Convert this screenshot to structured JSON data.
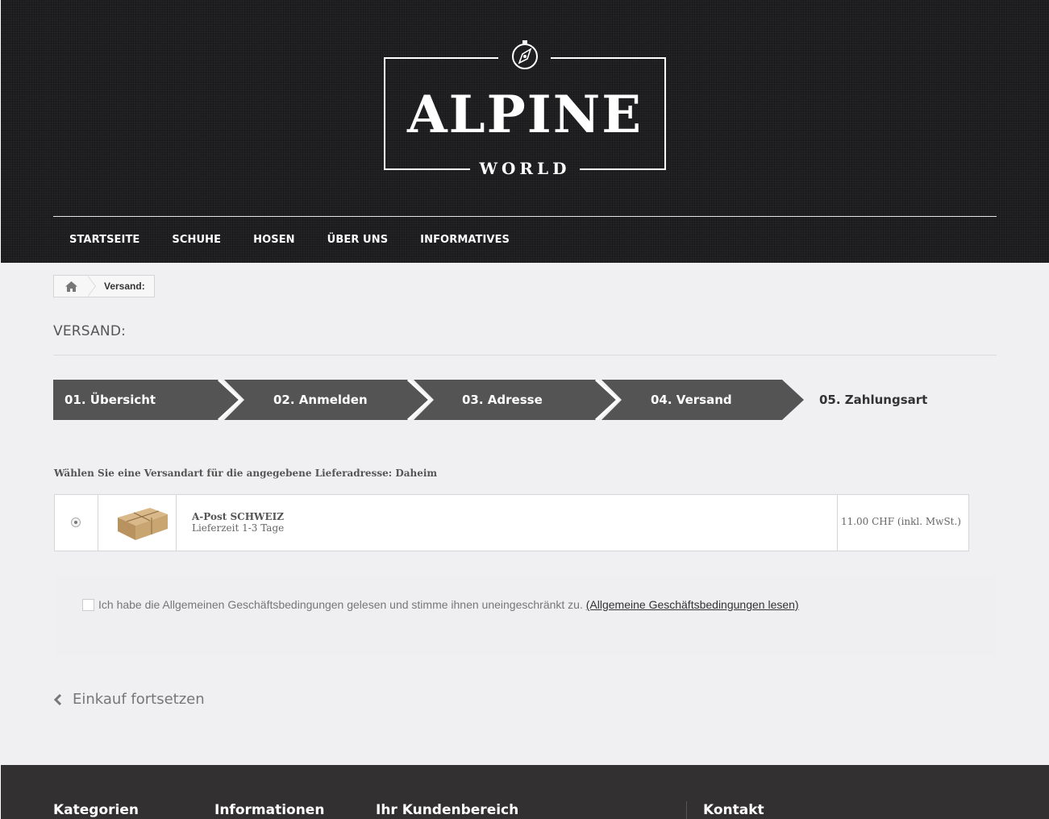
{
  "brand": {
    "name": "ALPINE",
    "sub": "WORLD"
  },
  "nav": {
    "items": [
      "STARTSEITE",
      "SCHUHE",
      "HOSEN",
      "ÜBER UNS",
      "INFORMATIVES"
    ]
  },
  "breadcrumb": {
    "current": "Versand:"
  },
  "page": {
    "title": "VERSAND:"
  },
  "steps": [
    {
      "label": "01. Übersicht"
    },
    {
      "label": "02. Anmelden"
    },
    {
      "label": "03. Adresse"
    },
    {
      "label": "04. Versand"
    },
    {
      "label": "05. Zahlungsart"
    }
  ],
  "shipping": {
    "instruction": "Wählen Sie eine Versandart für die angegebene Lieferadresse: Daheim",
    "carrier": {
      "name": "A-Post SCHWEIZ",
      "delay": "Lieferzeit 1-3 Tage",
      "price": "11.00 CHF (inkl. MwSt.)"
    }
  },
  "terms": {
    "text": "Ich habe die Allgemeinen Geschäftsbedingungen gelesen und stimme ihnen uneingeschränkt zu.",
    "link": "(Allgemeine Geschäftsbedingungen lesen)"
  },
  "continue_label": "Einkauf fortsetzen",
  "footer": {
    "headings": [
      "Kategorien",
      "Informationen",
      "Ihr Kundenbereich",
      "Kontakt"
    ]
  },
  "colors": {
    "header_bg": "#1f1f21",
    "step_active": "#555454",
    "footer_bg": "#333031"
  }
}
